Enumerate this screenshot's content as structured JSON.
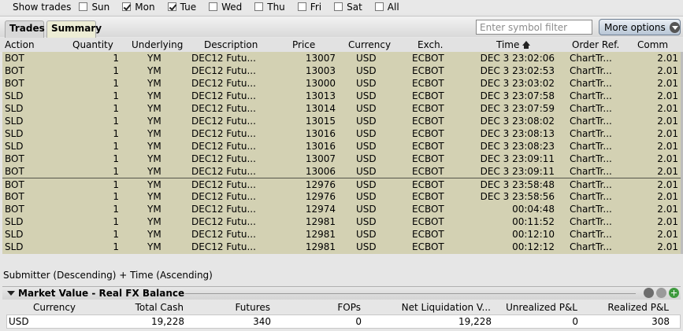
{
  "day_filter": {
    "label": "Show trades",
    "days": [
      {
        "label": "Sun",
        "checked": false
      },
      {
        "label": "Mon",
        "checked": true
      },
      {
        "label": "Tue",
        "checked": true
      },
      {
        "label": "Wed",
        "checked": false
      },
      {
        "label": "Thu",
        "checked": false
      },
      {
        "label": "Fri",
        "checked": false
      },
      {
        "label": "Sat",
        "checked": false
      },
      {
        "label": "All",
        "checked": false
      }
    ]
  },
  "tabs": {
    "trades": "Trades",
    "summary": "Summary",
    "symbol_placeholder": "Enter symbol filter",
    "more_options": "More options"
  },
  "trades_table": {
    "columns": [
      "Action",
      "Quantity",
      "Underlying",
      "Description",
      "Price",
      "Currency",
      "Exch.",
      "Time",
      "Order Ref.",
      "Comm"
    ],
    "sort_column": "Time",
    "rows": [
      [
        "BOT",
        "1",
        "YM",
        "DEC12 Futu...",
        "13007",
        "USD",
        "ECBOT",
        "DEC 3 23:02:06",
        "ChartTr...",
        "2.01"
      ],
      [
        "BOT",
        "1",
        "YM",
        "DEC12 Futu...",
        "13003",
        "USD",
        "ECBOT",
        "DEC 3 23:02:53",
        "ChartTr...",
        "2.01"
      ],
      [
        "BOT",
        "1",
        "YM",
        "DEC12 Futu...",
        "13000",
        "USD",
        "ECBOT",
        "DEC 3 23:03:02",
        "ChartTr...",
        "2.01"
      ],
      [
        "SLD",
        "1",
        "YM",
        "DEC12 Futu...",
        "13013",
        "USD",
        "ECBOT",
        "DEC 3 23:07:58",
        "ChartTr...",
        "2.01"
      ],
      [
        "SLD",
        "1",
        "YM",
        "DEC12 Futu...",
        "13014",
        "USD",
        "ECBOT",
        "DEC 3 23:07:59",
        "ChartTr...",
        "2.01"
      ],
      [
        "SLD",
        "1",
        "YM",
        "DEC12 Futu...",
        "13015",
        "USD",
        "ECBOT",
        "DEC 3 23:08:02",
        "ChartTr...",
        "2.01"
      ],
      [
        "SLD",
        "1",
        "YM",
        "DEC12 Futu...",
        "13016",
        "USD",
        "ECBOT",
        "DEC 3 23:08:13",
        "ChartTr...",
        "2.01"
      ],
      [
        "SLD",
        "1",
        "YM",
        "DEC12 Futu...",
        "13016",
        "USD",
        "ECBOT",
        "DEC 3 23:08:23",
        "ChartTr...",
        "2.01"
      ],
      [
        "BOT",
        "1",
        "YM",
        "DEC12 Futu...",
        "13007",
        "USD",
        "ECBOT",
        "DEC 3 23:09:11",
        "ChartTr...",
        "2.01"
      ],
      [
        "BOT",
        "1",
        "YM",
        "DEC12 Futu...",
        "13006",
        "USD",
        "ECBOT",
        "DEC 3 23:09:11",
        "ChartTr...",
        "2.01"
      ],
      [
        "BOT",
        "1",
        "YM",
        "DEC12 Futu...",
        "12976",
        "USD",
        "ECBOT",
        "DEC 3 23:58:48",
        "ChartTr...",
        "2.01"
      ],
      [
        "BOT",
        "1",
        "YM",
        "DEC12 Futu...",
        "12976",
        "USD",
        "ECBOT",
        "DEC 3 23:58:56",
        "ChartTr...",
        "2.01"
      ],
      [
        "BOT",
        "1",
        "YM",
        "DEC12 Futu...",
        "12974",
        "USD",
        "ECBOT",
        "00:04:48",
        "ChartTr...",
        "2.01"
      ],
      [
        "SLD",
        "1",
        "YM",
        "DEC12 Futu...",
        "12981",
        "USD",
        "ECBOT",
        "00:11:52",
        "ChartTr...",
        "2.01"
      ],
      [
        "SLD",
        "1",
        "YM",
        "DEC12 Futu...",
        "12981",
        "USD",
        "ECBOT",
        "00:12:10",
        "ChartTr...",
        "2.01"
      ],
      [
        "SLD",
        "1",
        "YM",
        "DEC12 Futu...",
        "12981",
        "USD",
        "ECBOT",
        "00:12:12",
        "ChartTr...",
        "2.01"
      ]
    ]
  },
  "sort_status": "Submitter (Descending)  +  Time (Ascending)",
  "balance_panel": {
    "title": "Market Value - Real FX Balance",
    "columns": [
      "Currency",
      "Total Cash",
      "Futures",
      "FOPs",
      "Net Liquidation V...",
      "Unrealized P&L",
      "Realized P&L"
    ],
    "row": [
      "USD",
      "19,228",
      "340",
      "0",
      "19,228",
      "0",
      "308"
    ]
  },
  "colors": {
    "table_background": "#d3d1b3",
    "summary_tab": "#ededd5",
    "add_button": "#3e9a3e"
  }
}
